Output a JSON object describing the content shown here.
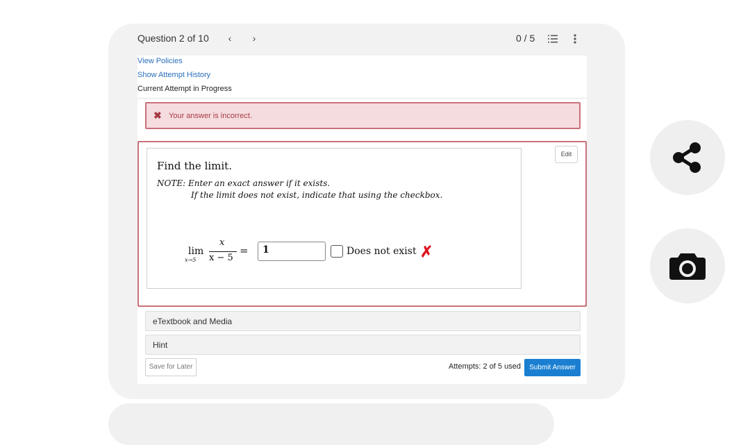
{
  "header": {
    "question_label": "Question 2 of 10",
    "prev_glyph": "‹",
    "next_glyph": "›",
    "score": "0 / 5"
  },
  "links": {
    "view_policies": "View Policies",
    "show_attempt_history": "Show Attempt History"
  },
  "status_text": "Current Attempt in Progress",
  "feedback": {
    "icon": "✖",
    "message": "Your answer is incorrect."
  },
  "question": {
    "edit_label": "Edit",
    "prompt": "Find the limit.",
    "note_line1": "NOTE: Enter an exact answer if it exists.",
    "note_line2": "If the limit does not exist, indicate that using the checkbox.",
    "lim_word": "lim",
    "lim_sub": "x→5",
    "numerator": "x",
    "denominator": "x − 5",
    "equals": "=",
    "answer_value": "1",
    "dne_label": "Does not exist",
    "dne_checked": false,
    "result_mark": "✗"
  },
  "accordion": {
    "etextbook": "eTextbook and Media",
    "hint": "Hint"
  },
  "footer": {
    "save_label": "Save for Later",
    "attempts": "Attempts: 2 of 5 used",
    "submit_label": "Submit Answer"
  },
  "colors": {
    "submit_blue": "#1a7fd1",
    "error_red": "#c9707a",
    "wrong_mark": "#e0141f",
    "link_blue": "#2a6ebb"
  },
  "icons": {
    "share": "share-icon",
    "camera": "camera-icon",
    "list": "list-icon",
    "kebab": "kebab-menu-icon"
  }
}
